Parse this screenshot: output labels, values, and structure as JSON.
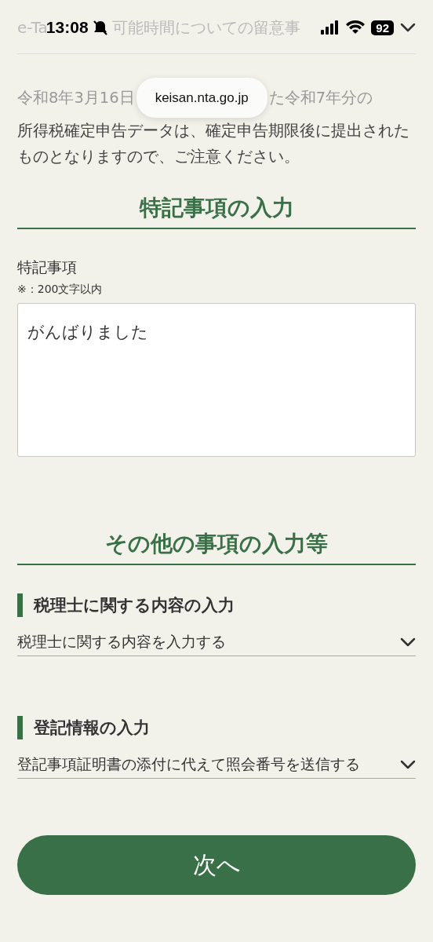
{
  "status_bar": {
    "time": "13:08",
    "battery": "92"
  },
  "collapsed_notice": {
    "fragments": [
      "e-Ta",
      "可能時間についての留意事"
    ],
    "expanded": false
  },
  "url_pill": "keisan.nta.go.jp",
  "notice": {
    "line_start": "令和8年3月16日",
    "line_resume": "た令和7年分の",
    "rest": "所得税確定申告データは、確定申告期限後に提出されたものとなりますので、ご注意ください。"
  },
  "sections": [
    {
      "title": "特記事項の入力",
      "field": {
        "label": "特記事項",
        "note": "※：200文字以内",
        "value": "がんばりました"
      }
    },
    {
      "title": "その他の事項の入力等",
      "subsections": [
        {
          "heading": "税理士に関する内容の入力",
          "select": "税理士に関する内容を入力する"
        },
        {
          "heading": "登記情報の入力",
          "select": "登記事項証明書の添付に代えて照会番号を送信する"
        }
      ]
    }
  ],
  "next_button": "次へ"
}
